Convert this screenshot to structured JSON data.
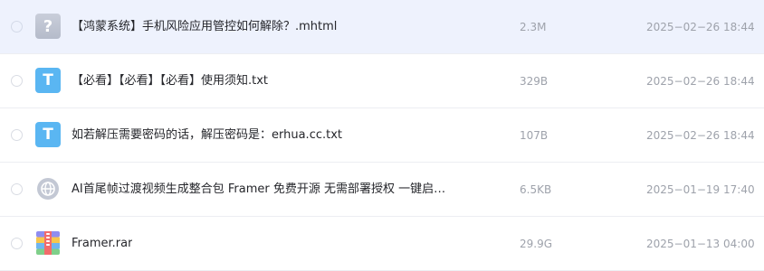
{
  "files": [
    {
      "icon": "unknown-file-icon",
      "glyph": "?",
      "name": "【鸿蒙系统】手机风险应用管控如何解除？.mhtml",
      "size": "2.3M",
      "date": "2025−02−26 18:44",
      "selected": true
    },
    {
      "icon": "text-file-icon",
      "glyph": "T",
      "name": "【必看】【必看】【必看】使用须知.txt",
      "size": "329B",
      "date": "2025−02−26 18:44",
      "selected": false
    },
    {
      "icon": "text-file-icon",
      "glyph": "T",
      "name": "如若解压需要密码的话，解压密码是：erhua.cc.txt",
      "size": "107B",
      "date": "2025−02−26 18:44",
      "selected": false
    },
    {
      "icon": "link-file-icon",
      "glyph": "",
      "name": "AI首尾帧过渡视频生成整合包 Framer 免费开源 无需部署授权 一键启…",
      "size": "6.5KB",
      "date": "2025−01−19 17:40",
      "selected": false
    },
    {
      "icon": "archive-file-icon",
      "glyph": "",
      "name": "Framer.rar",
      "size": "29.9G",
      "date": "2025−01−13 04:00",
      "selected": false
    }
  ],
  "colors": {
    "selected_row": "#eef2fd",
    "txt_icon": "#5ab6f2",
    "unknown_icon": "#bcc2cf",
    "meta_text": "#9ea2ab",
    "name_text": "#25262b"
  }
}
